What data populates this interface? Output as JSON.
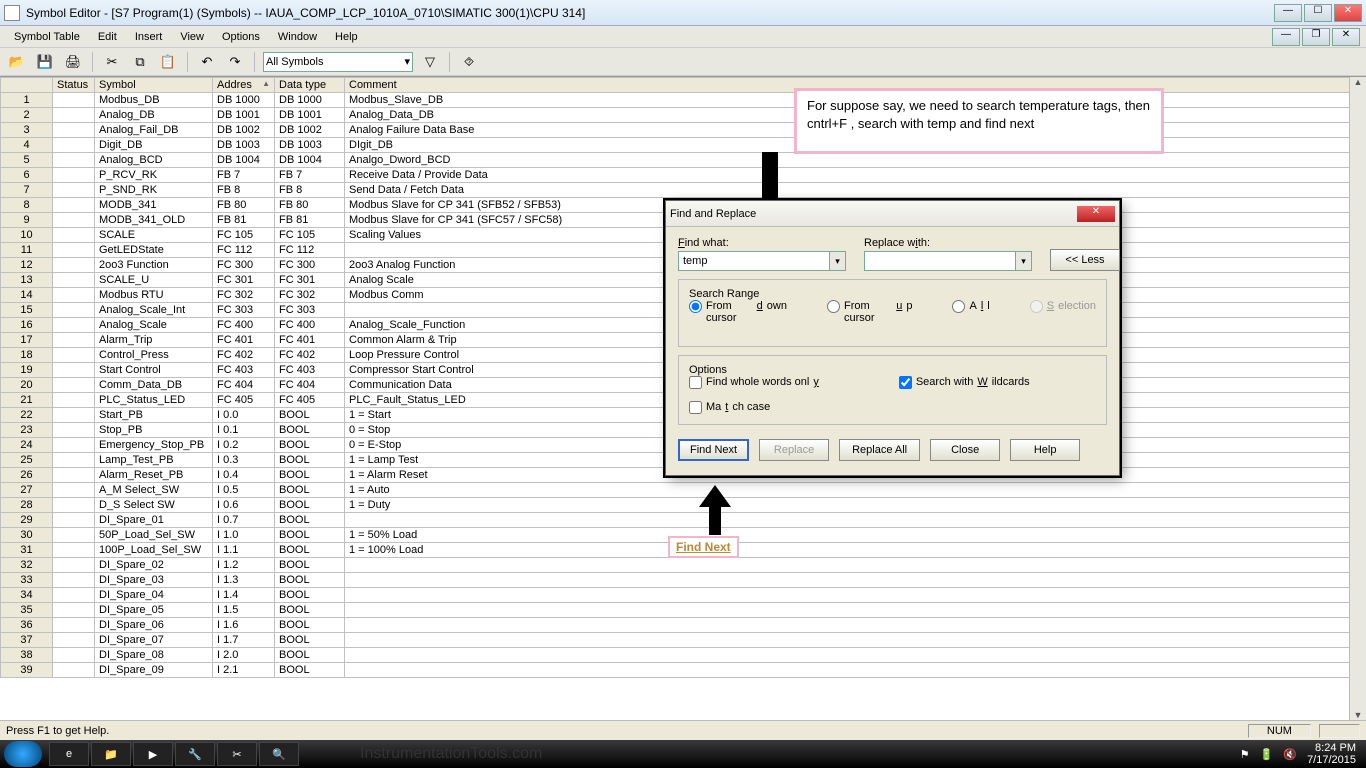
{
  "titlebar": "Symbol Editor - [S7 Program(1) (Symbols) -- IAUA_COMP_LCP_1010A_0710\\SIMATIC 300(1)\\CPU 314]",
  "menus": [
    "Symbol Table",
    "Edit",
    "Insert",
    "View",
    "Options",
    "Window",
    "Help"
  ],
  "filter_label": "All Symbols",
  "columns": [
    "",
    "Status",
    "Symbol",
    "Addres",
    "Data type",
    "Comment"
  ],
  "rows": [
    {
      "n": "1",
      "sym": "Modbus_DB",
      "addr": "DB   1000",
      "dt": "DB   1000",
      "cm": "Modbus_Slave_DB"
    },
    {
      "n": "2",
      "sym": "Analog_DB",
      "addr": "DB   1001",
      "dt": "DB   1001",
      "cm": "Analog_Data_DB"
    },
    {
      "n": "3",
      "sym": "Analog_Fail_DB",
      "addr": "DB   1002",
      "dt": "DB   1002",
      "cm": "Analog Failure Data Base"
    },
    {
      "n": "4",
      "sym": "Digit_DB",
      "addr": "DB   1003",
      "dt": "DB   1003",
      "cm": "DIgit_DB"
    },
    {
      "n": "5",
      "sym": "Analog_BCD",
      "addr": "DB   1004",
      "dt": "DB   1004",
      "cm": "Analgo_Dword_BCD"
    },
    {
      "n": "6",
      "sym": "P_RCV_RK",
      "addr": "FB       7",
      "dt": "FB       7",
      "cm": "Receive Data / Provide Data"
    },
    {
      "n": "7",
      "sym": "P_SND_RK",
      "addr": "FB       8",
      "dt": "FB       8",
      "cm": "Send Data / Fetch Data"
    },
    {
      "n": "8",
      "sym": "MODB_341",
      "addr": "FB     80",
      "dt": "FB     80",
      "cm": "Modbus Slave for CP 341 (SFB52 / SFB53)"
    },
    {
      "n": "9",
      "sym": "MODB_341_OLD",
      "addr": "FB     81",
      "dt": "FB     81",
      "cm": "Modbus Slave for CP 341 (SFC57 / SFC58)"
    },
    {
      "n": "10",
      "sym": "SCALE",
      "addr": "FC   105",
      "dt": "FC   105",
      "cm": "Scaling Values"
    },
    {
      "n": "11",
      "sym": "GetLEDState",
      "addr": "FC   112",
      "dt": "FC   112",
      "cm": ""
    },
    {
      "n": "12",
      "sym": "2oo3 Function",
      "addr": "FC   300",
      "dt": "FC   300",
      "cm": "2oo3 Analog Function"
    },
    {
      "n": "13",
      "sym": "SCALE_U",
      "addr": "FC   301",
      "dt": "FC   301",
      "cm": "Analog Scale"
    },
    {
      "n": "14",
      "sym": "Modbus RTU",
      "addr": "FC   302",
      "dt": "FC   302",
      "cm": "Modbus Comm"
    },
    {
      "n": "15",
      "sym": "Analog_Scale_Int",
      "addr": "FC   303",
      "dt": "FC   303",
      "cm": ""
    },
    {
      "n": "16",
      "sym": "Analog_Scale",
      "addr": "FC   400",
      "dt": "FC   400",
      "cm": "Analog_Scale_Function"
    },
    {
      "n": "17",
      "sym": "Alarm_Trip",
      "addr": "FC   401",
      "dt": "FC   401",
      "cm": "Common Alarm & Trip"
    },
    {
      "n": "18",
      "sym": "Control_Press",
      "addr": "FC   402",
      "dt": "FC   402",
      "cm": "Loop Pressure Control"
    },
    {
      "n": "19",
      "sym": "Start Control",
      "addr": "FC   403",
      "dt": "FC   403",
      "cm": "Compressor Start Control"
    },
    {
      "n": "20",
      "sym": "Comm_Data_DB",
      "addr": "FC   404",
      "dt": "FC   404",
      "cm": "Communication Data"
    },
    {
      "n": "21",
      "sym": "PLC_Status_LED",
      "addr": "FC   405",
      "dt": "FC   405",
      "cm": "PLC_Fault_Status_LED"
    },
    {
      "n": "22",
      "sym": "Start_PB",
      "addr": "I       0.0",
      "dt": "BOOL",
      "cm": "1 = Start"
    },
    {
      "n": "23",
      "sym": "Stop_PB",
      "addr": "I       0.1",
      "dt": "BOOL",
      "cm": "0 = Stop"
    },
    {
      "n": "24",
      "sym": "Emergency_Stop_PB",
      "addr": "I       0.2",
      "dt": "BOOL",
      "cm": "0 = E-Stop"
    },
    {
      "n": "25",
      "sym": "Lamp_Test_PB",
      "addr": "I       0.3",
      "dt": "BOOL",
      "cm": "1 = Lamp Test"
    },
    {
      "n": "26",
      "sym": "Alarm_Reset_PB",
      "addr": "I       0.4",
      "dt": "BOOL",
      "cm": "1 = Alarm Reset"
    },
    {
      "n": "27",
      "sym": "A_M Select_SW",
      "addr": "I       0.5",
      "dt": "BOOL",
      "cm": "1 = Auto"
    },
    {
      "n": "28",
      "sym": "D_S Select SW",
      "addr": "I       0.6",
      "dt": "BOOL",
      "cm": "1 = Duty"
    },
    {
      "n": "29",
      "sym": "DI_Spare_01",
      "addr": "I       0.7",
      "dt": "BOOL",
      "cm": ""
    },
    {
      "n": "30",
      "sym": "50P_Load_Sel_SW",
      "addr": "I       1.0",
      "dt": "BOOL",
      "cm": "1 = 50% Load"
    },
    {
      "n": "31",
      "sym": "100P_Load_Sel_SW",
      "addr": "I       1.1",
      "dt": "BOOL",
      "cm": "1 = 100% Load"
    },
    {
      "n": "32",
      "sym": "DI_Spare_02",
      "addr": "I       1.2",
      "dt": "BOOL",
      "cm": ""
    },
    {
      "n": "33",
      "sym": "DI_Spare_03",
      "addr": "I       1.3",
      "dt": "BOOL",
      "cm": ""
    },
    {
      "n": "34",
      "sym": "DI_Spare_04",
      "addr": "I       1.4",
      "dt": "BOOL",
      "cm": ""
    },
    {
      "n": "35",
      "sym": "DI_Spare_05",
      "addr": "I       1.5",
      "dt": "BOOL",
      "cm": ""
    },
    {
      "n": "36",
      "sym": "DI_Spare_06",
      "addr": "I       1.6",
      "dt": "BOOL",
      "cm": ""
    },
    {
      "n": "37",
      "sym": "DI_Spare_07",
      "addr": "I       1.7",
      "dt": "BOOL",
      "cm": ""
    },
    {
      "n": "38",
      "sym": "DI_Spare_08",
      "addr": "I       2.0",
      "dt": "BOOL",
      "cm": ""
    },
    {
      "n": "39",
      "sym": "DI_Spare_09",
      "addr": "I       2.1",
      "dt": "BOOL",
      "cm": ""
    }
  ],
  "statusbar": {
    "help": "Press F1 to get Help.",
    "num": "NUM"
  },
  "dialog": {
    "title": "Find and Replace",
    "find_label": "Find what:",
    "replace_label": "Replace with:",
    "find_value": "temp",
    "replace_value": "",
    "less_btn": "<<  Less",
    "range_legend": "Search Range",
    "radios": [
      "From cursor down",
      "From cursor up",
      "All",
      "Selection"
    ],
    "radio_selected": 0,
    "options_legend": "Options",
    "chk_whole": "Find whole words only",
    "chk_case": "Match case",
    "chk_wild": "Search with Wildcards",
    "buttons": {
      "findnext": "Find Next",
      "replace": "Replace",
      "replaceall": "Replace All",
      "close": "Close",
      "help": "Help"
    }
  },
  "anno_box": "For suppose say, we need to search temperature tags, then cntrl+F , search with temp and find next",
  "anno_findnext": "Find Next",
  "taskbar": {
    "time": "8:24 PM",
    "date": "7/17/2015",
    "watermark": "InstrumentationTools.com"
  }
}
